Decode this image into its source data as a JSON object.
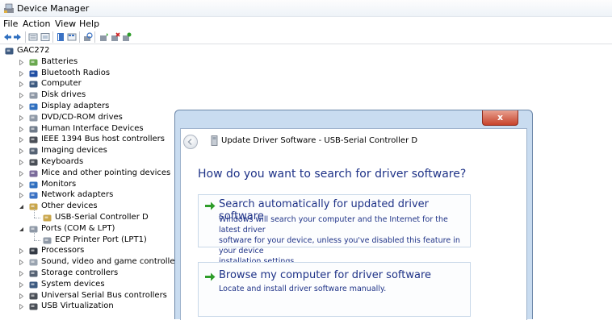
{
  "window": {
    "title": "Device Manager"
  },
  "menu": [
    "File",
    "Action",
    "View",
    "Help"
  ],
  "tree": {
    "root": "GAC272",
    "items": [
      {
        "label": "Batteries",
        "icon": "battery-icon"
      },
      {
        "label": "Bluetooth Radios",
        "icon": "bluetooth-icon"
      },
      {
        "label": "Computer",
        "icon": "computer-icon"
      },
      {
        "label": "Disk drives",
        "icon": "disk-drive-icon"
      },
      {
        "label": "Display adapters",
        "icon": "display-adapter-icon"
      },
      {
        "label": "DVD/CD-ROM drives",
        "icon": "dvd-drive-icon"
      },
      {
        "label": "Human Interface Devices",
        "icon": "hid-icon"
      },
      {
        "label": "IEEE 1394 Bus host controllers",
        "icon": "ieee1394-icon"
      },
      {
        "label": "Imaging devices",
        "icon": "imaging-device-icon"
      },
      {
        "label": "Keyboards",
        "icon": "keyboard-icon"
      },
      {
        "label": "Mice and other pointing devices",
        "icon": "mouse-icon"
      },
      {
        "label": "Monitors",
        "icon": "monitor-icon"
      },
      {
        "label": "Network adapters",
        "icon": "network-adapter-icon"
      },
      {
        "label": "Other devices",
        "icon": "other-devices-icon"
      },
      {
        "label": "USB-Serial Controller D",
        "icon": "unknown-device-icon"
      },
      {
        "label": "Ports (COM & LPT)",
        "icon": "port-icon"
      },
      {
        "label": "ECP Printer Port (LPT1)",
        "icon": "printer-port-icon"
      },
      {
        "label": "Processors",
        "icon": "processor-icon"
      },
      {
        "label": "Sound, video and game controllers",
        "icon": "sound-icon"
      },
      {
        "label": "Storage controllers",
        "icon": "storage-controller-icon"
      },
      {
        "label": "System devices",
        "icon": "system-devices-icon"
      },
      {
        "label": "Universal Serial Bus controllers",
        "icon": "usb-icon"
      },
      {
        "label": "USB Virtualization",
        "icon": "usb-icon"
      }
    ]
  },
  "dialog": {
    "title": "Update Driver Software - USB-Serial Controller D",
    "close_label": "x",
    "question": "How do you want to search for driver software?",
    "options": [
      {
        "title": "Search automatically for updated driver software",
        "desc_lines": [
          "Windows will search your computer and the Internet for the latest driver",
          "software for your device, unless you've disabled this feature in your device",
          "installation settings."
        ]
      },
      {
        "title": "Browse my computer for driver software",
        "desc_lines": [
          "Locate and install driver software manually."
        ]
      }
    ]
  },
  "colors": {
    "link_blue": "#1e3287",
    "arrow_green": "#2e9d2a",
    "close_red": "#c7432b"
  }
}
